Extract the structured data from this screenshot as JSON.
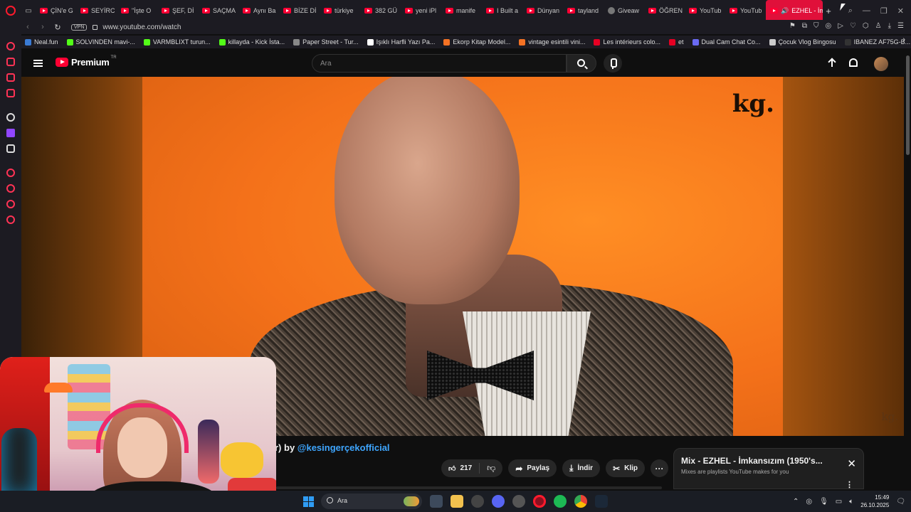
{
  "browser": {
    "tabs": [
      {
        "label": "ÇİN'e G"
      },
      {
        "label": "SEYİRC"
      },
      {
        "label": "\"İşte O"
      },
      {
        "label": "ŞEF, Dİ"
      },
      {
        "label": "SAÇMA"
      },
      {
        "label": "Aynı Ba"
      },
      {
        "label": "BİZE Dİ"
      },
      {
        "label": "türkiye"
      },
      {
        "label": "382 GÜ"
      },
      {
        "label": "yeni iPl"
      },
      {
        "label": "manife"
      },
      {
        "label": "I Built a"
      },
      {
        "label": "Dünyan"
      },
      {
        "label": "tayland"
      },
      {
        "label": "Giveaw"
      },
      {
        "label": "ÖĞREN"
      },
      {
        "label": "YouTub"
      },
      {
        "label": "YouTub"
      }
    ],
    "active_tab": {
      "label": "EZHEL - İm"
    },
    "url": "www.youtube.com/watch",
    "vpn_label": "VPN",
    "bookmarks": [
      {
        "label": "Neal.fun",
        "color": "#3a7bd5"
      },
      {
        "label": "SOLVINDEN mavi-...",
        "color": "#53fc18"
      },
      {
        "label": "VARMBLIXT turun...",
        "color": "#53fc18"
      },
      {
        "label": "killayda - Kick İsta...",
        "color": "#53fc18"
      },
      {
        "label": "Paper Street - Tur...",
        "color": "#888888"
      },
      {
        "label": "Işıklı Harfli Yazı Pa...",
        "color": "#ffffff"
      },
      {
        "label": "Ekorp Kitap Model...",
        "color": "#f57224"
      },
      {
        "label": "vintage esintili vini...",
        "color": "#f57224"
      },
      {
        "label": "Les intérieurs colo...",
        "color": "#e60023"
      },
      {
        "label": "et",
        "color": "#e60023"
      },
      {
        "label": "Dual Cam Chat Co...",
        "color": "#6a6af4"
      },
      {
        "label": "Çocuk Vlog Bingosu",
        "color": "#cccccc"
      },
      {
        "label": "IBANEZ AF75G-B...",
        "color": "#333333"
      }
    ]
  },
  "youtube": {
    "logo_text": "Premium",
    "logo_region": "TR",
    "search_placeholder": "Ara",
    "watermark": "kg.",
    "video_title_tail": "r) by",
    "channel_handle": "@kesingerçekofficial",
    "like_count": "217",
    "share_label": "Paylaş",
    "download_label": "İndir",
    "clip_label": "Klip",
    "more_label": "···",
    "mix_title": "Mix - EZHEL - İmkansızım (1950's...",
    "mix_subtitle": "Mixes are playlists YouTube makes for you"
  },
  "taskbar": {
    "search_label": "Ara",
    "time": "15:49",
    "date": "26.10.2025"
  },
  "colors": {
    "youtube_red": "#ff0033",
    "opera_red": "#ff1b2d",
    "link_blue": "#3ea6ff",
    "frame_orange": "#f4711a"
  }
}
